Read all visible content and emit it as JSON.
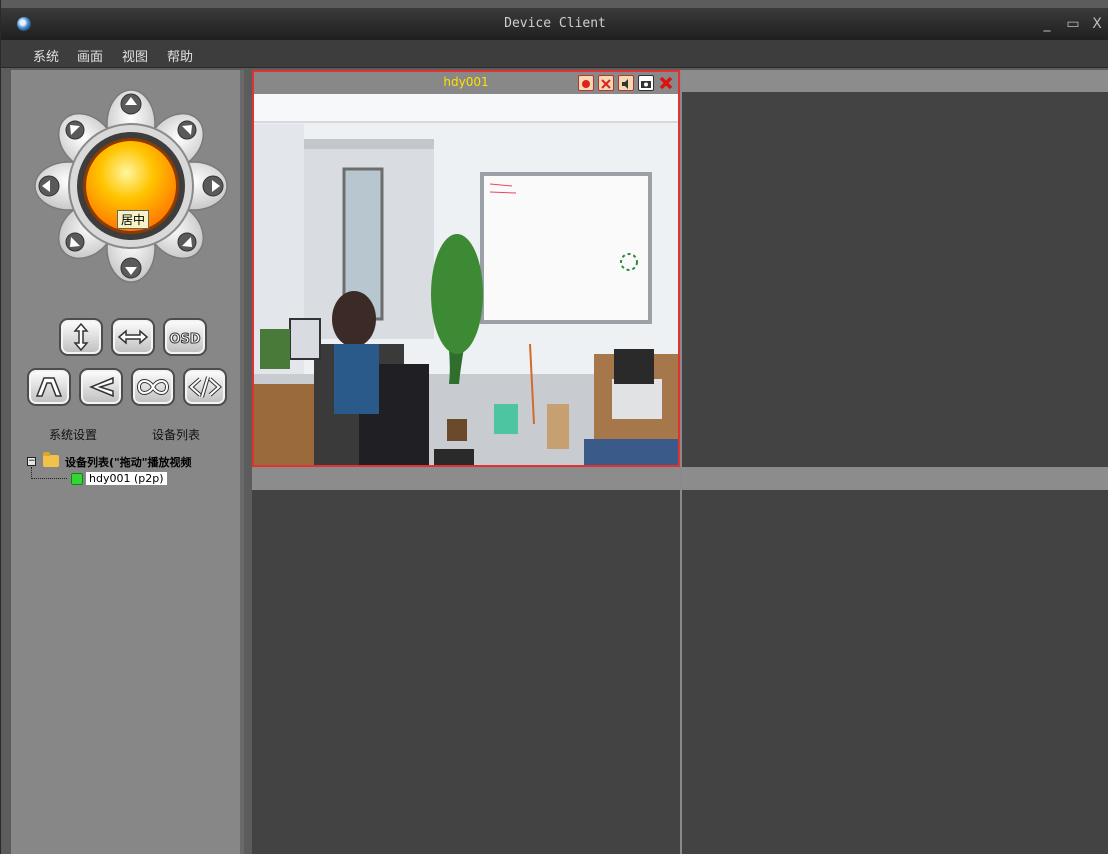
{
  "window": {
    "title": "Device Client",
    "minimize": "_",
    "maximize": "▭",
    "close": "X"
  },
  "menu": {
    "items": [
      "系统",
      "画面",
      "视图",
      "帮助"
    ]
  },
  "ptz": {
    "center_label": "居中"
  },
  "panel": {
    "system_settings": "系统设置",
    "device_list": "设备列表"
  },
  "tree": {
    "root_label": "设备列表(\"拖动\"播放视频",
    "device_label": "hdy001 (p2p)"
  },
  "video": {
    "active_camera": "hdy001",
    "toolbar_icons": [
      "record-icon",
      "talk-icon",
      "audio-icon",
      "snapshot-icon",
      "close-icon"
    ]
  },
  "colors": {
    "active_border": "#e13232",
    "camera_title": "#ffe000",
    "online_dot": "#33d633"
  }
}
